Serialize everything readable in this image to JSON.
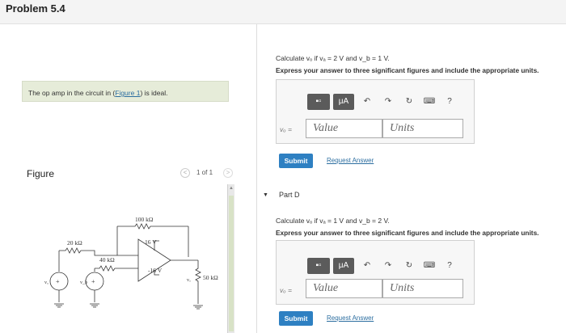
{
  "header": {
    "title": "Problem 5.4"
  },
  "intro": {
    "pre": "The op amp in the circuit in (",
    "link": "Figure 1",
    "post": ") is ideal."
  },
  "figure": {
    "label": "Figure",
    "pager_prev": "<",
    "pager_count": "1 of 1",
    "pager_next": ">",
    "circuit_labels": {
      "r1": "20 kΩ",
      "r2": "40 kΩ",
      "r3": "100 kΩ",
      "r4": "50 kΩ",
      "vpos": "16 V",
      "vneg": "-16 V",
      "src_a": "vₐ",
      "src_b": "v_b",
      "out": "vₒ"
    }
  },
  "part_c": {
    "question": "Calculate vₒ if vₐ = 2 V and v_b = 1 V.",
    "instruction": "Express your answer to three significant figures and include the appropriate units.",
    "variable_label": "vₒ =",
    "value_placeholder": "Value",
    "units_placeholder": "Units",
    "submit_label": "Submit",
    "request_label": "Request Answer"
  },
  "part_d": {
    "arrow": "▼",
    "title": "Part D",
    "question": "Calculate vₒ if vₐ = 1 V and v_b = 2 V.",
    "instruction": "Express your answer to three significant figures and include the appropriate units.",
    "variable_label": "vₒ =",
    "value_placeholder": "Value",
    "units_placeholder": "Units",
    "submit_label": "Submit",
    "request_label": "Request Answer"
  },
  "toolbar": {
    "templates": "▪▫",
    "micro": "μA",
    "undo": "↶",
    "redo": "↷",
    "reset": "↻",
    "keyboard": "⌨",
    "help": "?"
  }
}
